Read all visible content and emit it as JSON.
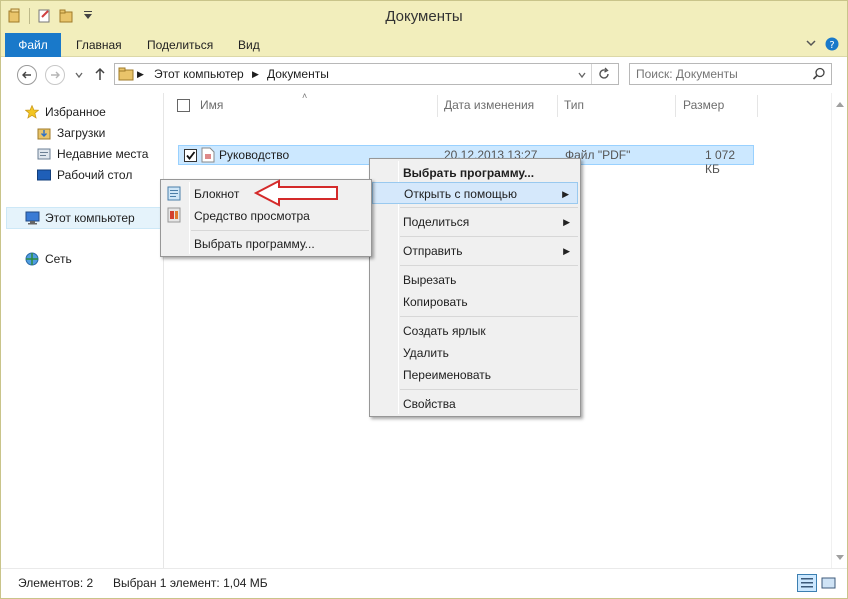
{
  "window": {
    "title": "Документы"
  },
  "ribbon": {
    "tabs": [
      "Файл",
      "Главная",
      "Поделиться",
      "Вид"
    ],
    "collapse_icon": "chevron-down-icon",
    "help_icon": "help-icon"
  },
  "address": {
    "crumbs": [
      "Этот компьютер",
      "Документы"
    ],
    "search_placeholder": "Поиск: Документы"
  },
  "nav": {
    "favorites": "Избранное",
    "downloads": "Загрузки",
    "recent": "Недавние места",
    "desktop": "Рабочий стол",
    "computer": "Этот компьютер",
    "network": "Сеть"
  },
  "columns": {
    "name": "Имя",
    "date": "Дата изменения",
    "type": "Тип",
    "size": "Размер"
  },
  "file": {
    "name": "Руководство",
    "date": "20.12.2013 13:27",
    "type": "Файл \"PDF\"",
    "size": "1 072 КБ"
  },
  "context_menu": {
    "choose_program": "Выбрать программу...",
    "open_with": "Открыть с помощью",
    "share": "Поделиться",
    "send_to": "Отправить",
    "cut": "Вырезать",
    "copy": "Копировать",
    "create_shortcut": "Создать ярлык",
    "delete": "Удалить",
    "rename": "Переименовать",
    "properties": "Свойства"
  },
  "submenu": {
    "notepad": "Блокнот",
    "viewer": "Средство просмотра",
    "choose_program": "Выбрать программу..."
  },
  "status": {
    "items": "Элементов: 2",
    "selected": "Выбран 1 элемент: 1,04 МБ"
  },
  "colors": {
    "accent": "#1979ca",
    "selection": "#cce8ff",
    "titlebar": "#f2eebc",
    "annotation_arrow": "#d42a2a"
  }
}
